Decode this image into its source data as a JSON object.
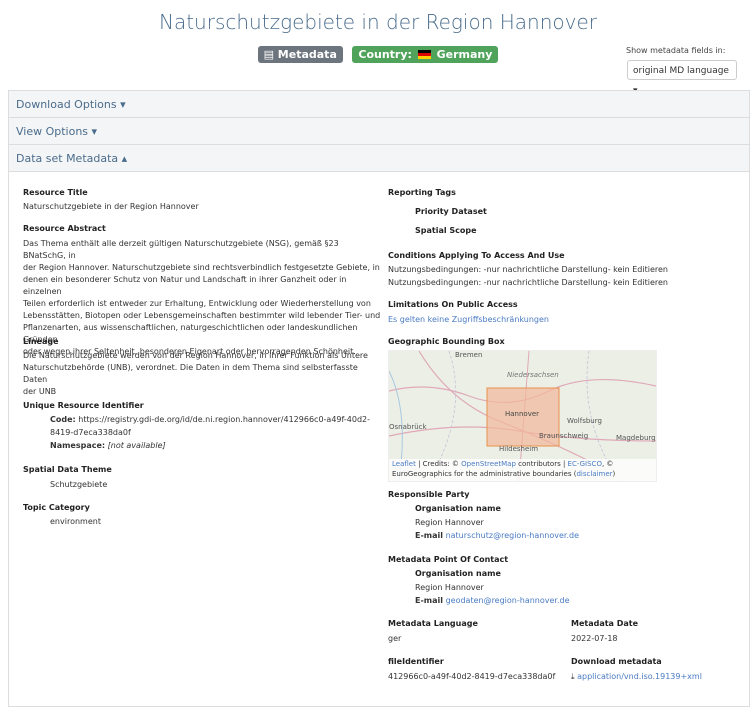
{
  "title": "Naturschutzgebiete in der Region Hannover",
  "badges": {
    "metadata": "Metadata",
    "country_label": "Country:",
    "country_value": "Germany"
  },
  "md_fields": {
    "label": "Show metadata fields in:",
    "selected": "original MD language",
    "arrow": "▾"
  },
  "panels": {
    "download": "Download Options",
    "view": "View Options",
    "metadata": "Data set Metadata",
    "caret_down": "▾",
    "caret_up": "▴"
  },
  "left": {
    "resource_title_label": "Resource Title",
    "resource_title": "Naturschutzgebiete in der Region Hannover",
    "abstract_label": "Resource Abstract",
    "abstract": [
      "Das Thema enthält alle derzeit gültigen Naturschutzgebiete (NSG), gemäß §23 BNatSchG, in",
      "der Region Hannover. Naturschutzgebiete sind rechtsverbindlich festgesetzte Gebiete, in",
      "denen ein besonderer Schutz von Natur und Landschaft in ihrer Ganzheit oder in einzelnen",
      "Teilen erforderlich ist entweder zur Erhaltung, Entwicklung oder Wiederherstellung von",
      "Lebensstätten, Biotopen oder Lebensgemeinschaften bestimmter wild lebender Tier- und",
      "Pflanzenarten, aus wissenschaftlichen, naturgeschichtlichen oder landeskundlichen Gründen",
      "oder wegen ihrer Seltenheit, besonderen Eigenart oder hervorragenden Schönheit."
    ],
    "lineage_label": "Lineage",
    "lineage": [
      "Die Naturschutzgebiete werden von der Region Hannover, in ihrer Funktion als Untere",
      "Naturschutzbehörde (UNB), verordnet. Die Daten in dem Thema sind selbsterfasste Daten",
      "der UNB"
    ],
    "uri_label": "Unique Resource Identifier",
    "code_label": "Code:",
    "code_line1": "https://registry.gdi-de.org/id/de.ni.region.hannover/412966c0-a49f-40d2-",
    "code_line2": "8419-d7eca338da0f",
    "namespace_label": "Namespace:",
    "namespace_value": "[not available]",
    "theme_label": "Spatial Data Theme",
    "theme": "Schutzgebiete",
    "topic_label": "Topic Category",
    "topic": "environment"
  },
  "right": {
    "tags_label": "Reporting Tags",
    "tag1": "Priority Dataset",
    "tag2": "Spatial Scope",
    "conditions_label": "Conditions Applying To Access And Use",
    "conditions1": "Nutzungsbedingungen: -nur nachrichtliche Darstellung- kein Editieren",
    "conditions2": "Nutzungsbedingungen: -nur nachrichtliche Darstellung- kein Editieren",
    "limitations_label": "Limitations On Public Access",
    "limitations": "Es gelten keine Zugriffsbeschränkungen",
    "bbox_label": "Geographic Bounding Box",
    "map_labels": {
      "bremen": "Bremen",
      "niedersachsen": "Niedersachsen",
      "hannover": "Hannover",
      "osnabrueck": "Osnabrück",
      "wolfsburg": "Wolfsburg",
      "braunschweig": "Braunschweig",
      "magdeburg": "Magdeburg",
      "hildesheim": "Hildesheim"
    },
    "attribution_leaflet": "Leaflet",
    "attribution_credits": " | Credits: © ",
    "attribution_osm": "OpenStreetMap",
    "attribution_contrib": " contributors | ",
    "attribution_gisco": "EC-GISCO",
    "attribution_rest": ", ©",
    "attribution_line2": "EuroGeographics for the administrative boundaries (",
    "attribution_disclaimer": "disclaimer",
    "attribution_close": ")",
    "party_label": "Responsible Party",
    "org_label": "Organisation name",
    "org_name": "Region Hannover",
    "email_label": "E-mail",
    "email": "naturschutz@region-hannover.de",
    "poc_label": "Metadata Point Of Contact",
    "poc_org_label": "Organisation name",
    "poc_org": "Region Hannover",
    "poc_email_label": "E-mail",
    "poc_email": "geodaten@region-hannover.de",
    "md_lang_label": "Metadata Language",
    "md_lang": "ger",
    "md_date_label": "Metadata Date",
    "md_date": "2022-07-18",
    "fileid_label": "fileIdentifier",
    "fileid": "412966c0-a49f-40d2-8419-d7eca338da0f",
    "download_label": "Download metadata",
    "download_link": "application/vnd.iso.19139+xml"
  },
  "colors": {
    "accent": "#4a6c8c",
    "link": "#4a7bc4",
    "badge_gray": "#6c757d",
    "badge_green": "#4fa35a",
    "bbox_fill": "#f2b89a"
  }
}
